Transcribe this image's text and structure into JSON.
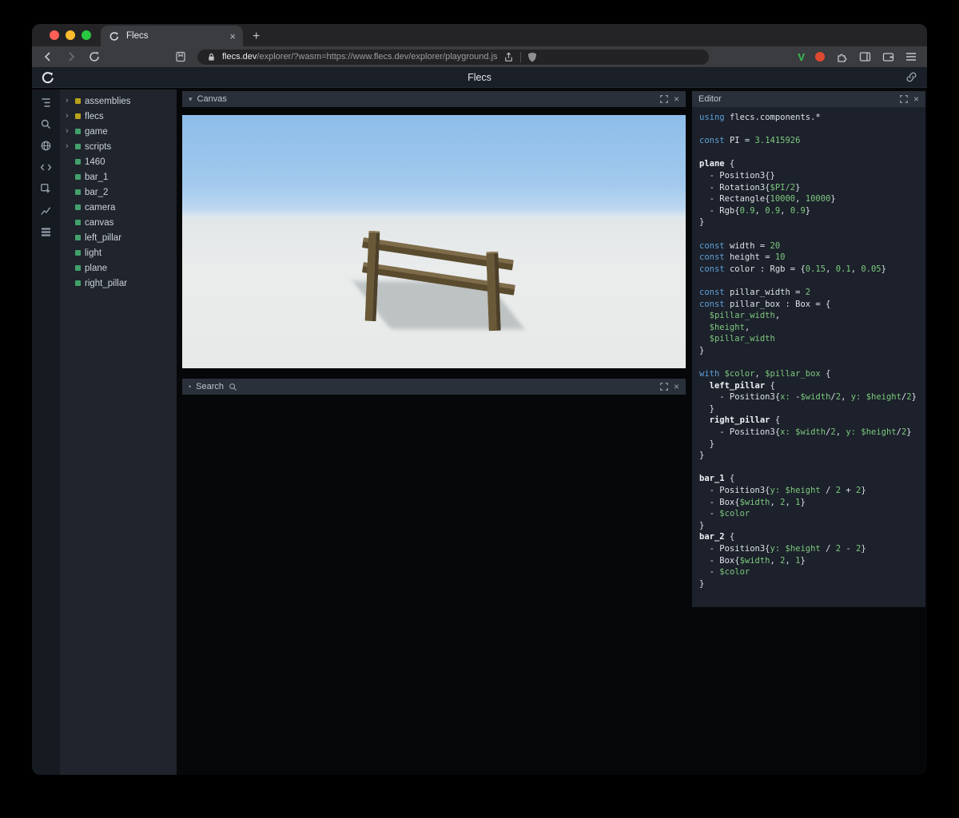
{
  "glyphs": {
    "chevron_right": "›",
    "panel_marker_down": "▾",
    "panel_marker_dot": "•",
    "close": "×",
    "plus": "+"
  },
  "browser": {
    "traffic_colors": [
      "#ff5f57",
      "#febc2e",
      "#28c840"
    ],
    "tab_title": "Flecs",
    "url_primary": "flecs.dev",
    "url_secondary": "/explorer/?wasm=https://www.flecs.dev/explorer/playground.js",
    "extension_v": "V"
  },
  "app": {
    "title": "Flecs"
  },
  "panels": {
    "canvas": "Canvas",
    "search": "Search",
    "editor": "Editor"
  },
  "sidebar_icons": [
    "entity-tree-icon",
    "search-icon",
    "globe-icon",
    "code-icon",
    "inspect-icon",
    "stats-icon",
    "rows-icon"
  ],
  "scene": {
    "sky_top": "#8cbde9",
    "ground": "#e9ebeb",
    "wood": "#6a5939"
  },
  "tree": {
    "items": [
      {
        "label": "assemblies",
        "arrow": true,
        "color": "#b9a21c"
      },
      {
        "label": "flecs",
        "arrow": true,
        "color": "#b9a21c"
      },
      {
        "label": "game",
        "arrow": true,
        "color": "#43a06a"
      },
      {
        "label": "scripts",
        "arrow": true,
        "color": "#43a06a"
      },
      {
        "label": "1460",
        "arrow": false,
        "color": "#43a06a"
      },
      {
        "label": "bar_1",
        "arrow": false,
        "color": "#43a06a"
      },
      {
        "label": "bar_2",
        "arrow": false,
        "color": "#43a06a"
      },
      {
        "label": "camera",
        "arrow": false,
        "color": "#43a06a"
      },
      {
        "label": "canvas",
        "arrow": false,
        "color": "#43a06a"
      },
      {
        "label": "left_pillar",
        "arrow": false,
        "color": "#43a06a"
      },
      {
        "label": "light",
        "arrow": false,
        "color": "#43a06a"
      },
      {
        "label": "plane",
        "arrow": false,
        "color": "#43a06a"
      },
      {
        "label": "right_pillar",
        "arrow": false,
        "color": "#43a06a"
      }
    ]
  },
  "editor_code": {
    "token_colors": {
      "keyword": "#5fa0d8",
      "value": "#7ec87e",
      "plain": "#dde2e8",
      "entity": "#eef2f6"
    },
    "lines": [
      [
        [
          "k",
          "using "
        ],
        [
          "p",
          "flecs.components.*"
        ]
      ],
      [],
      [
        [
          "k",
          "const "
        ],
        [
          "p",
          "PI = "
        ],
        [
          "g",
          "3.1415926"
        ]
      ],
      [],
      [
        [
          "e",
          "plane"
        ],
        [
          "p",
          " {"
        ]
      ],
      [
        [
          "p",
          "  - Position3{}"
        ]
      ],
      [
        [
          "p",
          "  - Rotation3{"
        ],
        [
          "g",
          "$PI/2"
        ],
        [
          "p",
          "}"
        ]
      ],
      [
        [
          "p",
          "  - Rectangle{"
        ],
        [
          "g",
          "10000"
        ],
        [
          "p",
          ", "
        ],
        [
          "g",
          "10000"
        ],
        [
          "p",
          "}"
        ]
      ],
      [
        [
          "p",
          "  - Rgb{"
        ],
        [
          "g",
          "0.9"
        ],
        [
          "p",
          ", "
        ],
        [
          "g",
          "0.9"
        ],
        [
          "p",
          ", "
        ],
        [
          "g",
          "0.9"
        ],
        [
          "p",
          "}"
        ]
      ],
      [
        [
          "p",
          "}"
        ]
      ],
      [],
      [
        [
          "k",
          "const "
        ],
        [
          "p",
          "width = "
        ],
        [
          "g",
          "20"
        ]
      ],
      [
        [
          "k",
          "const "
        ],
        [
          "p",
          "height = "
        ],
        [
          "g",
          "10"
        ]
      ],
      [
        [
          "k",
          "const "
        ],
        [
          "p",
          "color : Rgb = {"
        ],
        [
          "g",
          "0.15"
        ],
        [
          "p",
          ", "
        ],
        [
          "g",
          "0.1"
        ],
        [
          "p",
          ", "
        ],
        [
          "g",
          "0.05"
        ],
        [
          "p",
          "}"
        ]
      ],
      [],
      [
        [
          "k",
          "const "
        ],
        [
          "p",
          "pillar_width = "
        ],
        [
          "g",
          "2"
        ]
      ],
      [
        [
          "k",
          "const "
        ],
        [
          "p",
          "pillar_box : Box = {"
        ]
      ],
      [
        [
          "g",
          "  $pillar_width"
        ],
        [
          "p",
          ","
        ]
      ],
      [
        [
          "g",
          "  $height"
        ],
        [
          "p",
          ","
        ]
      ],
      [
        [
          "g",
          "  $pillar_width"
        ]
      ],
      [
        [
          "p",
          "}"
        ]
      ],
      [],
      [
        [
          "k",
          "with "
        ],
        [
          "g",
          "$color"
        ],
        [
          "p",
          ", "
        ],
        [
          "g",
          "$pillar_box"
        ],
        [
          "p",
          " {"
        ]
      ],
      [
        [
          "e",
          "  left_pillar"
        ],
        [
          "p",
          " {"
        ]
      ],
      [
        [
          "p",
          "    - Position3{"
        ],
        [
          "g",
          "x:"
        ],
        [
          "p",
          " -"
        ],
        [
          "g",
          "$width"
        ],
        [
          "p",
          "/"
        ],
        [
          "g",
          "2"
        ],
        [
          "p",
          ", "
        ],
        [
          "g",
          "y:"
        ],
        [
          "p",
          " "
        ],
        [
          "g",
          "$height"
        ],
        [
          "p",
          "/"
        ],
        [
          "g",
          "2"
        ],
        [
          "p",
          "}"
        ]
      ],
      [
        [
          "p",
          "  }"
        ]
      ],
      [
        [
          "e",
          "  right_pillar"
        ],
        [
          "p",
          " {"
        ]
      ],
      [
        [
          "p",
          "    - Position3{"
        ],
        [
          "g",
          "x:"
        ],
        [
          "p",
          " "
        ],
        [
          "g",
          "$width"
        ],
        [
          "p",
          "/"
        ],
        [
          "g",
          "2"
        ],
        [
          "p",
          ", "
        ],
        [
          "g",
          "y:"
        ],
        [
          "p",
          " "
        ],
        [
          "g",
          "$height"
        ],
        [
          "p",
          "/"
        ],
        [
          "g",
          "2"
        ],
        [
          "p",
          "}"
        ]
      ],
      [
        [
          "p",
          "  }"
        ]
      ],
      [
        [
          "p",
          "}"
        ]
      ],
      [],
      [
        [
          "e",
          "bar_1"
        ],
        [
          "p",
          " {"
        ]
      ],
      [
        [
          "p",
          "  - Position3{"
        ],
        [
          "g",
          "y:"
        ],
        [
          "p",
          " "
        ],
        [
          "g",
          "$height"
        ],
        [
          "p",
          " / "
        ],
        [
          "g",
          "2"
        ],
        [
          "p",
          " + "
        ],
        [
          "g",
          "2"
        ],
        [
          "p",
          "}"
        ]
      ],
      [
        [
          "p",
          "  - Box{"
        ],
        [
          "g",
          "$width"
        ],
        [
          "p",
          ", "
        ],
        [
          "g",
          "2"
        ],
        [
          "p",
          ", "
        ],
        [
          "g",
          "1"
        ],
        [
          "p",
          "}"
        ]
      ],
      [
        [
          "p",
          "  - "
        ],
        [
          "g",
          "$color"
        ]
      ],
      [
        [
          "p",
          "}"
        ]
      ],
      [
        [
          "e",
          "bar_2"
        ],
        [
          "p",
          " {"
        ]
      ],
      [
        [
          "p",
          "  - Position3{"
        ],
        [
          "g",
          "y:"
        ],
        [
          "p",
          " "
        ],
        [
          "g",
          "$height"
        ],
        [
          "p",
          " / "
        ],
        [
          "g",
          "2"
        ],
        [
          "p",
          " - "
        ],
        [
          "g",
          "2"
        ],
        [
          "p",
          "}"
        ]
      ],
      [
        [
          "p",
          "  - Box{"
        ],
        [
          "g",
          "$width"
        ],
        [
          "p",
          ", "
        ],
        [
          "g",
          "2"
        ],
        [
          "p",
          ", "
        ],
        [
          "g",
          "1"
        ],
        [
          "p",
          "}"
        ]
      ],
      [
        [
          "p",
          "  - "
        ],
        [
          "g",
          "$color"
        ]
      ],
      [
        [
          "p",
          "}"
        ]
      ]
    ]
  }
}
